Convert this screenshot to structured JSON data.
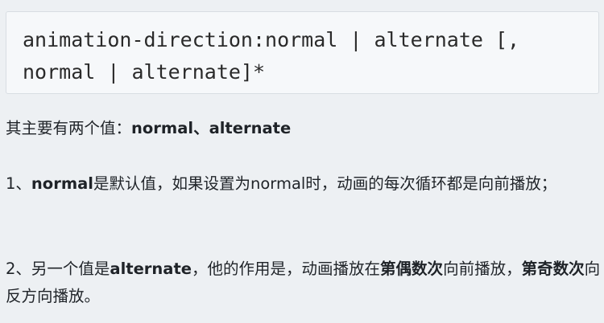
{
  "code": {
    "line1": "animation-direction:normal | alternate [,",
    "line2": "normal | alternate]*"
  },
  "para1": {
    "prefix": "其主要有两个值：",
    "bold": "normal、alternate"
  },
  "para2": {
    "prefix": "1、",
    "bold": "normal",
    "rest": "是默认值，如果设置为normal时，动画的每次循环都是向前播放；"
  },
  "para3": {
    "prefix": "2、另一个值是",
    "bold1": "alternate",
    "mid1": "，他的作用是，动画播放在",
    "bold2": "第偶数次",
    "mid2": "向前播放，",
    "bold3": "第奇数次",
    "end": "向反方向播放。"
  }
}
